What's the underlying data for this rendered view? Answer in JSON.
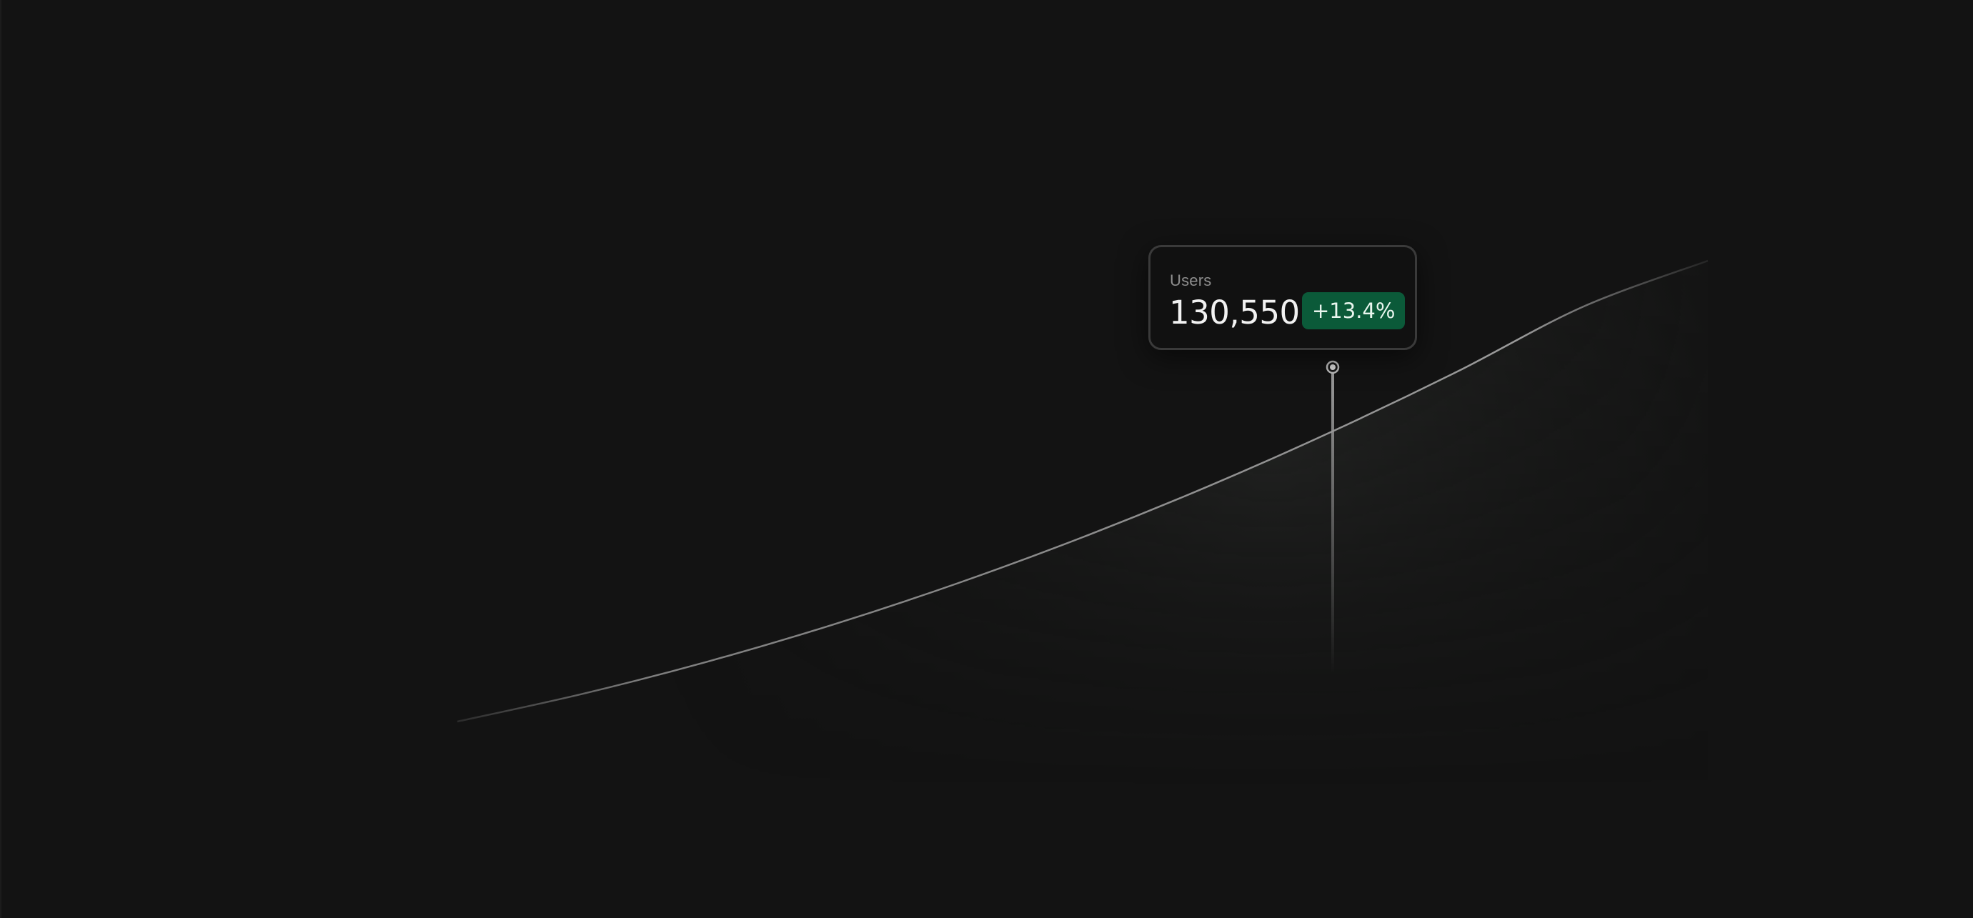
{
  "chart_data": {
    "type": "area",
    "series": [
      {
        "values": [
          0,
          6,
          13,
          21,
          30,
          40,
          51,
          63,
          76,
          90,
          100
        ]
      }
    ],
    "highlight": {
      "index": 7,
      "label": "Users",
      "value": "130,550",
      "change": "+13.4%"
    },
    "grid": false,
    "legend": "none"
  },
  "colors": {
    "background": "#131313",
    "line": "#8a8a8a",
    "badge": "#0b5a39",
    "badge_text": "#e9f6ee"
  }
}
